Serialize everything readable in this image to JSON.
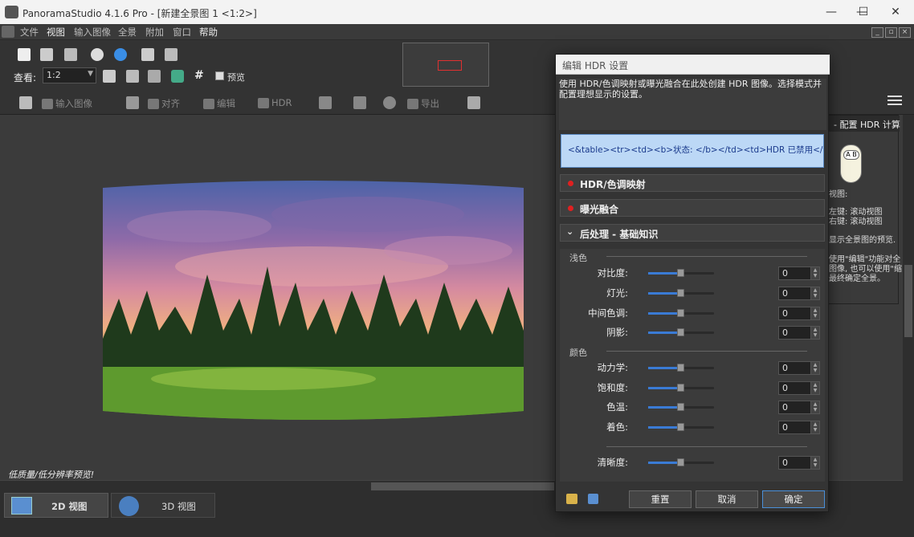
{
  "window": {
    "title": "PanoramaStudio 4.1.6 Pro - [新建全景图 1 <1:2>]",
    "controls": {
      "minimize": "—",
      "maximize": "☐",
      "close": "✕"
    }
  },
  "menu": [
    "文件",
    "视图",
    "输入图像",
    "全景",
    "附加",
    "窗口",
    "帮助"
  ],
  "view": {
    "label": "查看:",
    "zoom": "1:2",
    "preview_label": "预览"
  },
  "toolbar2": {
    "import": "输入图像",
    "align": "对齐",
    "edit": "编辑",
    "hdr": "HDR",
    "export": "导出"
  },
  "canvas": {
    "status": "低质量/低分辨率预览!"
  },
  "tabs": {
    "view2d": "2D 视图",
    "view3d": "3D 视图"
  },
  "side_panel": {
    "header": "- 配置 HDR 计算",
    "mouse_label": "A B",
    "lines": [
      "视图:",
      "左键: 滚动视图",
      "右键: 滚动视图",
      "显示全景图的预览.",
      "使用\"编辑\"功能对全",
      "图像, 也可以使用\"缩",
      "最终确定全景。"
    ]
  },
  "dialog": {
    "title": "编辑 HDR 设置",
    "intro": "使用 HDR/色调映射或曝光融合在此处创建 HDR 图像。选择模式并配置理想显示的设置。",
    "html_box": "<&table><tr><td><b>状态: </b></td><td>HDR 已禁用</td></",
    "sections": [
      {
        "label": "HDR/色调映射"
      },
      {
        "label": "曝光融合"
      },
      {
        "label": "后处理 - 基础知识"
      }
    ],
    "groups": {
      "light": "浅色",
      "color": "颜色"
    },
    "params": [
      {
        "label": "对比度:",
        "value": "0",
        "level": 0.5
      },
      {
        "label": "灯光:",
        "value": "0",
        "level": 0.5
      },
      {
        "label": "中间色调:",
        "value": "0",
        "level": 0.5
      },
      {
        "label": "阴影:",
        "value": "0",
        "level": 0.5
      },
      {
        "label": "动力学:",
        "value": "0",
        "level": 0.5
      },
      {
        "label": "饱和度:",
        "value": "0",
        "level": 0.5
      },
      {
        "label": "色温:",
        "value": "0",
        "level": 0.5
      },
      {
        "label": "着色:",
        "value": "0",
        "level": 0.5
      },
      {
        "label": "清晰度:",
        "value": "0",
        "level": 0.5
      }
    ],
    "buttons": {
      "reset": "重置",
      "cancel": "取消",
      "ok": "确定"
    }
  },
  "colors": {
    "accent": "#3a7bd5",
    "dot": "#e02020",
    "html_box_bg": "#bcd8f6"
  }
}
